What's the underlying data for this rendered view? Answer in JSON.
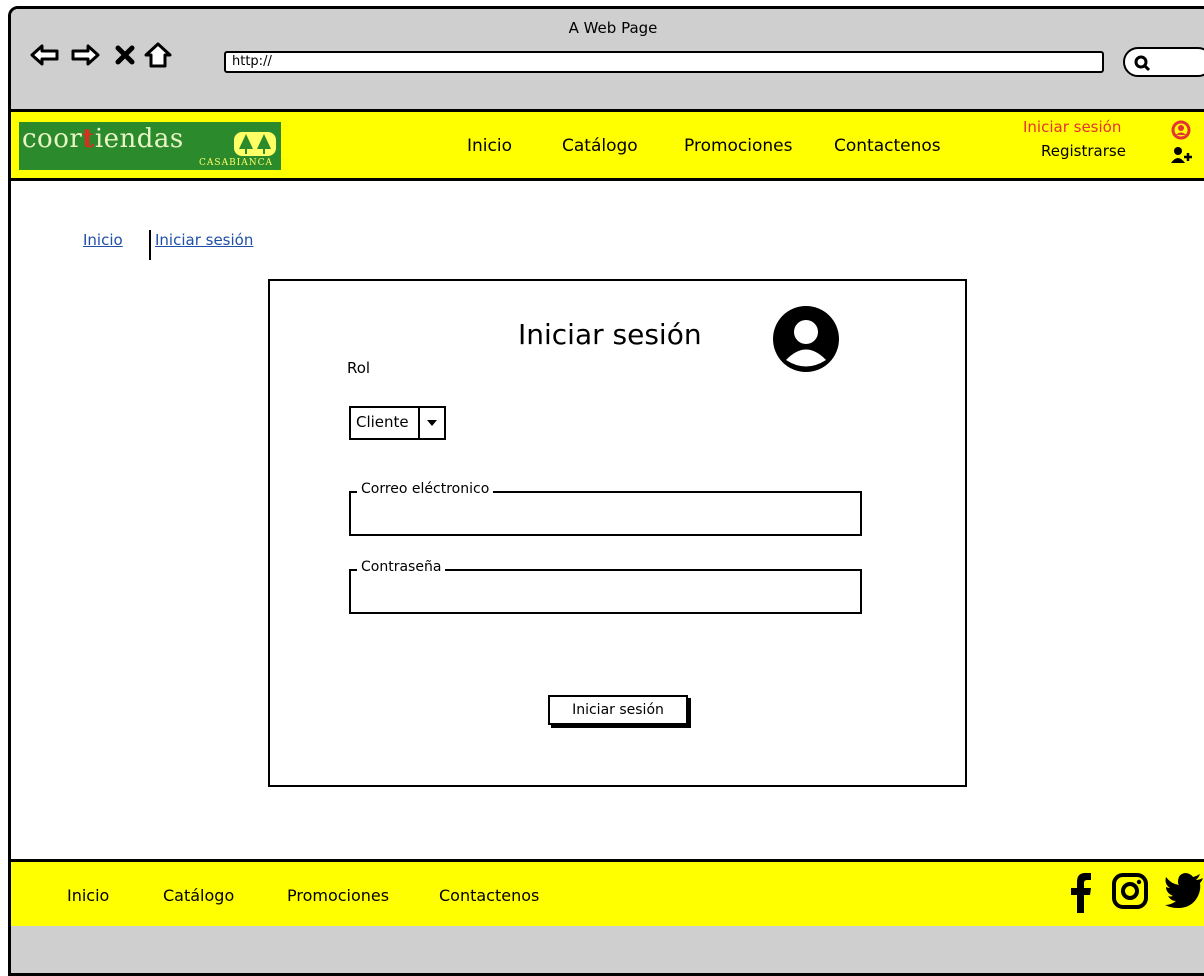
{
  "browser": {
    "title": "A Web Page",
    "url": "http://"
  },
  "header": {
    "logo": {
      "brand_prefix": "coor",
      "brand_t": "t",
      "brand_suffix": "iendas",
      "subtitle": "CASABIANCA"
    },
    "nav": [
      {
        "label": "Inicio"
      },
      {
        "label": "Catálogo"
      },
      {
        "label": "Promociones"
      },
      {
        "label": "Contactenos"
      }
    ],
    "login_label": "Iniciar sesión",
    "register_label": "Registrarse",
    "login_color": "#e53333"
  },
  "breadcrumb": [
    {
      "label": "Inicio"
    },
    {
      "label": "Iniciar sesión"
    }
  ],
  "login_card": {
    "title": "Iniciar sesión",
    "role_label": "Rol",
    "role_value": "Cliente",
    "email_label": "Correo eléctronico",
    "email_value": "",
    "password_label": "Contraseña",
    "password_value": "",
    "submit_label": "Iniciar sesión"
  },
  "footer": {
    "nav": [
      {
        "label": "Inicio"
      },
      {
        "label": "Catálogo"
      },
      {
        "label": "Promociones"
      },
      {
        "label": "Contactenos"
      }
    ],
    "social_icons": [
      "facebook-icon",
      "instagram-icon",
      "twitter-icon"
    ]
  },
  "colors": {
    "accent_yellow": "#ffff00",
    "logo_green": "#2b8a2b",
    "link_blue": "#1f4fa8",
    "chrome_gray": "#cfcfcf"
  }
}
